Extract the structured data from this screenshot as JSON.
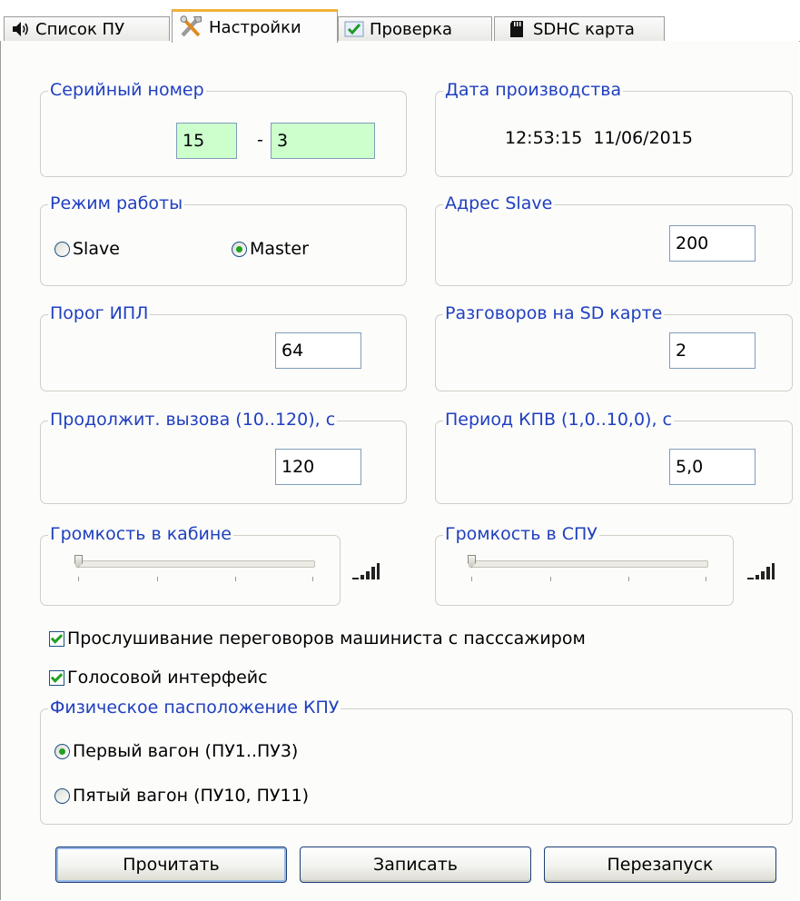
{
  "tabs": [
    {
      "label": "Список ПУ",
      "icon": "speaker-icon"
    },
    {
      "label": "Настройки",
      "icon": "tools-icon",
      "active": true
    },
    {
      "label": "Проверка",
      "icon": "checkmark-icon"
    },
    {
      "label": "SDHC карта",
      "icon": "sd-card-icon"
    }
  ],
  "serial": {
    "legend": "Серийный номер",
    "part1": "15",
    "separator": "-",
    "part2": "3"
  },
  "production_date": {
    "legend": "Дата производства",
    "value": "12:53:15  11/06/2015"
  },
  "mode": {
    "legend": "Режим работы",
    "slave_label": "Slave",
    "master_label": "Master",
    "selected": "Master"
  },
  "slave_address": {
    "legend": "Адрес Slave",
    "value": "200"
  },
  "ipl_threshold": {
    "legend": "Порог ИПЛ",
    "value": "64"
  },
  "sd_calls": {
    "legend": "Разговоров на SD карте",
    "value": "2"
  },
  "call_duration": {
    "legend": "Продолжит. вызова (10..120), с",
    "value": "120"
  },
  "kpv_period": {
    "legend": "Период КПВ (1,0..10,0), с",
    "value": "5,0"
  },
  "cabin_volume": {
    "legend": "Громкость в кабине",
    "level": 0
  },
  "spu_volume": {
    "legend": "Громкость в СПУ",
    "level": 0
  },
  "options": {
    "listen_label": "Прослушивание переговоров машиниста с пасссажиром",
    "listen_checked": true,
    "voice_label": "Голосовой интерфейс",
    "voice_checked": true
  },
  "location": {
    "legend": "Физическое пасположение КПУ",
    "first_label": "Первый вагон (ПУ1..ПУ3)",
    "fifth_label": "Пятый вагон (ПУ10, ПУ11)",
    "selected": "first"
  },
  "buttons": {
    "read": "Прочитать",
    "write": "Записать",
    "restart": "Перезапуск"
  },
  "colors": {
    "legend": "#1f3fbf",
    "field_green": "#ccffcc",
    "accent_tab": "#f2b03a",
    "check_green": "#21a121"
  }
}
